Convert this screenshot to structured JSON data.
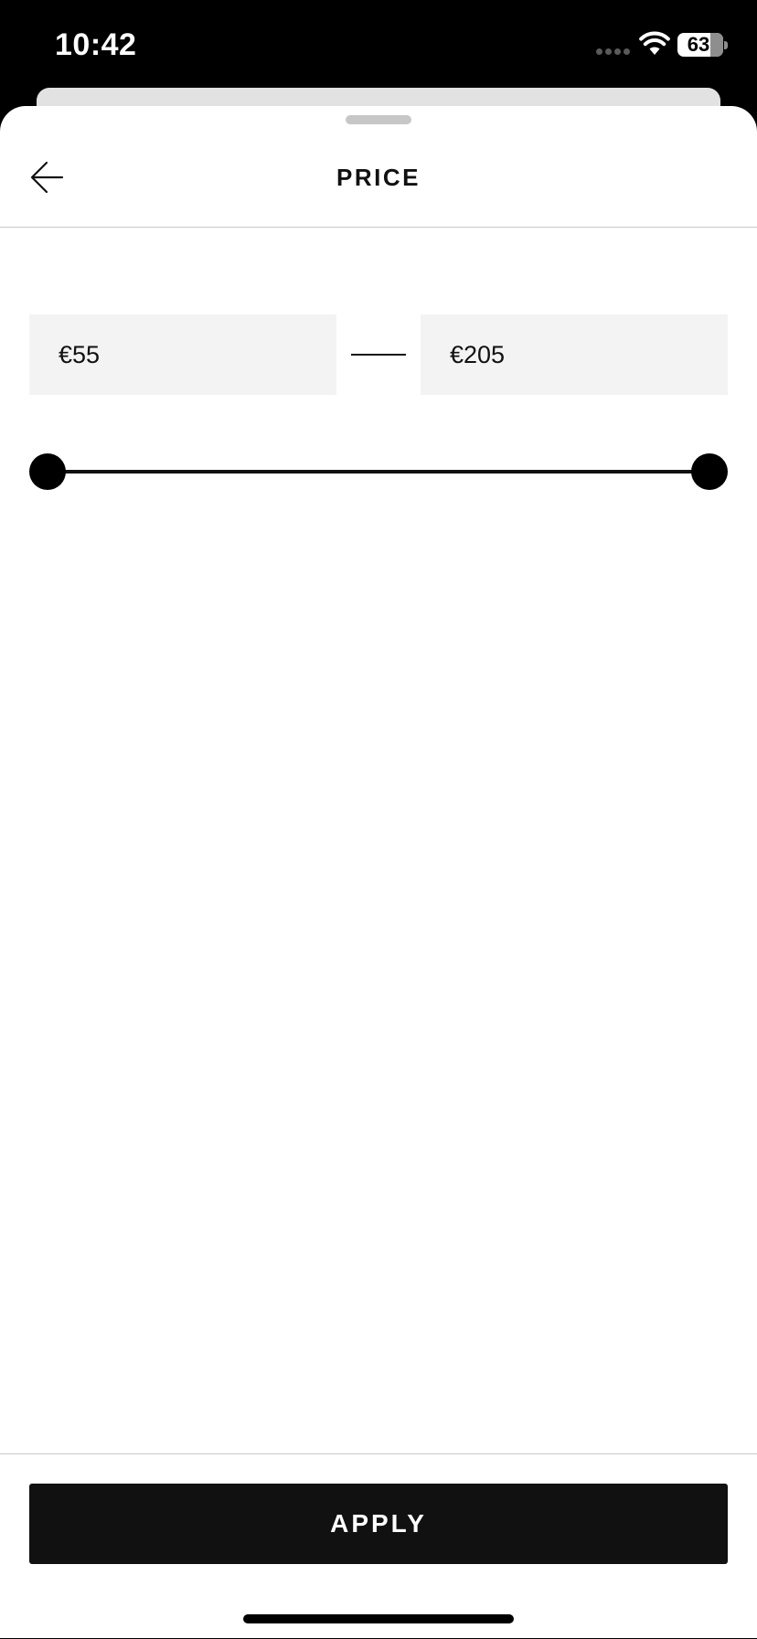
{
  "status_bar": {
    "time": "10:42",
    "battery_percent": "63",
    "battery_level": 0.63
  },
  "header": {
    "title": "PRICE",
    "back_icon": "arrow-left-icon"
  },
  "price_range": {
    "min_value": "€55",
    "max_value": "€205"
  },
  "slider": {
    "low_fraction": 0.0,
    "high_fraction": 1.0
  },
  "footer": {
    "apply_label": "APPLY"
  },
  "colors": {
    "primary": "#111111",
    "field_background": "#f3f3f3",
    "divider": "#c8c8c8"
  }
}
